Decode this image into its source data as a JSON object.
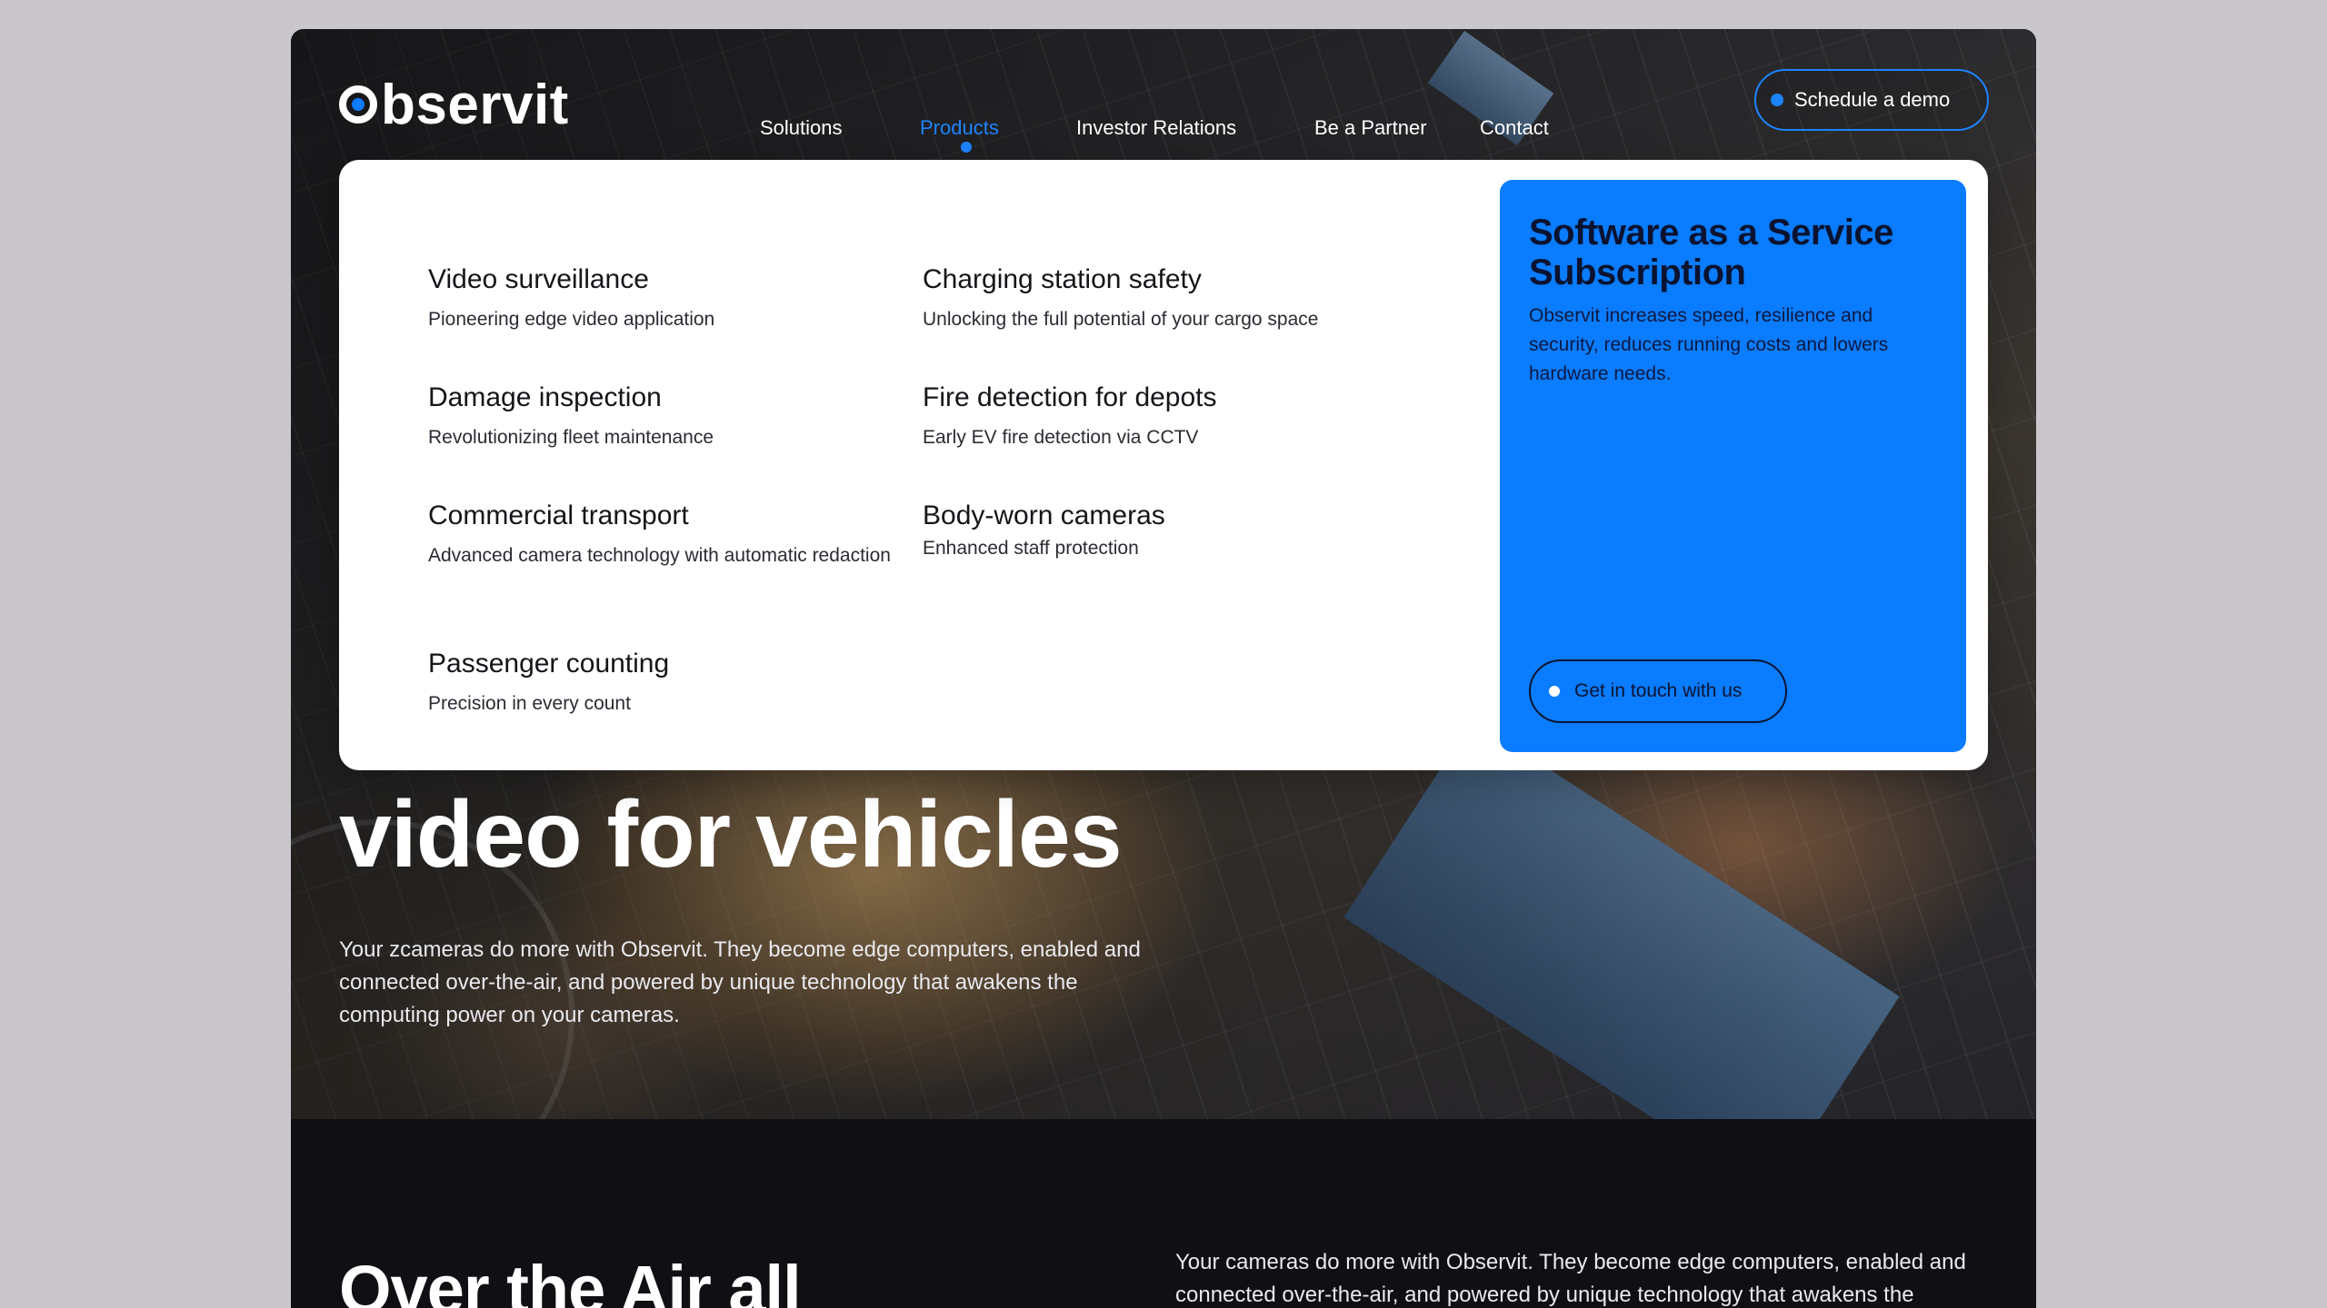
{
  "brand": {
    "name": "Observit"
  },
  "nav": {
    "items": [
      {
        "label": "Solutions"
      },
      {
        "label": "Products"
      },
      {
        "label": "Investor Relations"
      },
      {
        "label": "Be a Partner"
      },
      {
        "label": "Contact"
      }
    ],
    "active": "Products",
    "cta_label": "Schedule a demo"
  },
  "dropdown": {
    "items": [
      {
        "title": "Video surveillance",
        "desc": "Pioneering edge video application"
      },
      {
        "title": "Damage inspection",
        "desc": "Revolutionizing fleet maintenance"
      },
      {
        "title": "Commercial transport",
        "desc": "Advanced camera technology with automatic redaction"
      },
      {
        "title": "Passenger counting",
        "desc": "Precision in every count"
      },
      {
        "title": "Charging station safety",
        "desc": "Unlocking the full potential of your cargo space"
      },
      {
        "title": "Fire detection for depots",
        "desc": "Early EV fire detection via CCTV"
      },
      {
        "title": "Body-worn cameras",
        "desc": "Enhanced staff protection"
      }
    ],
    "card": {
      "title": "Software as a Service Subscription",
      "desc": "Observit increases speed, resilience and security, reduces running costs and lowers hardware needs.",
      "button": "Get in touch with us"
    }
  },
  "hero": {
    "title": "video for vehicles",
    "subtitle": "Your zcameras do more with Observit. They become edge computers, enabled and connected over-the-air, and powered by unique technology that awakens the computing power on your cameras."
  },
  "section": {
    "title": "Over the Air all",
    "text": "Your cameras do more with Observit. They become edge computers, enabled and connected over-the-air, and powered by unique technology that awakens the computing power on your cameras."
  },
  "colors": {
    "accent": "#0a7cff",
    "nav_active": "#1c84ff",
    "dark": "#0f0f14"
  }
}
